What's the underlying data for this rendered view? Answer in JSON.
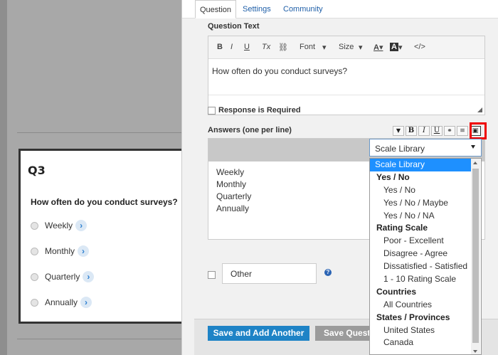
{
  "tabs": [
    {
      "label": "Question"
    },
    {
      "label": "Settings"
    },
    {
      "label": "Community"
    }
  ],
  "preview": {
    "question_number": "Q3",
    "question_text": "How often do you conduct surveys?",
    "options": [
      "Weekly",
      "Monthly",
      "Quarterly",
      "Annually"
    ]
  },
  "editor": {
    "question_text_label": "Question Text",
    "toolbar": {
      "bold": "B",
      "italic": "I",
      "underline": "U",
      "clear_format": "Tx",
      "font": "Font",
      "size": "Size",
      "source": "</>"
    },
    "question_text_value": "How often do you conduct surveys?",
    "response_required_label": "Response is Required",
    "answers_label": "Answers (one per line)",
    "answers": [
      "Weekly",
      "Monthly",
      "Quarterly",
      "Annually"
    ],
    "other_label": "Other",
    "help": "?",
    "save_and_add_label": "Save and Add Another",
    "save_question_label": "Save Question"
  },
  "scale_library": {
    "selected": "Scale Library",
    "items": [
      {
        "label": "Scale Library",
        "kind": "selected"
      },
      {
        "label": "Yes / No",
        "kind": "group"
      },
      {
        "label": "Yes / No",
        "kind": "option"
      },
      {
        "label": "Yes / No / Maybe",
        "kind": "option"
      },
      {
        "label": "Yes / No / NA",
        "kind": "option"
      },
      {
        "label": "Rating Scale",
        "kind": "group"
      },
      {
        "label": "Poor - Excellent",
        "kind": "option"
      },
      {
        "label": "Disagree - Agree",
        "kind": "option"
      },
      {
        "label": "Dissatisfied - Satisfied",
        "kind": "option"
      },
      {
        "label": "1 - 10 Rating Scale",
        "kind": "option"
      },
      {
        "label": "Countries",
        "kind": "group"
      },
      {
        "label": "All Countries",
        "kind": "option"
      },
      {
        "label": "States / Provinces",
        "kind": "group"
      },
      {
        "label": "United States",
        "kind": "option"
      },
      {
        "label": "Canada",
        "kind": "option"
      }
    ]
  },
  "colors": {
    "primary_button": "#1e83c6",
    "dropdown_selected": "#1e90ff",
    "highlight_box": "#e00000"
  }
}
